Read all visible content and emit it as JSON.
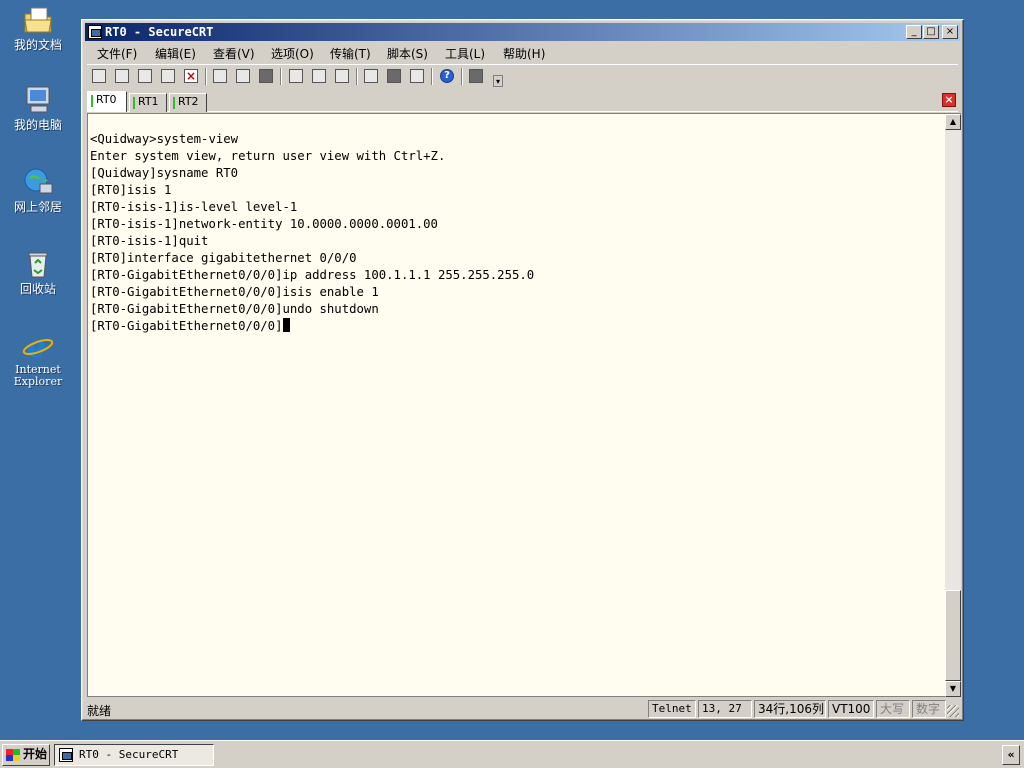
{
  "desktop": {
    "icons": [
      {
        "label": "我的文档",
        "icon": "my-documents-icon"
      },
      {
        "label": "我的电脑",
        "icon": "my-computer-icon"
      },
      {
        "label": "网上邻居",
        "icon": "network-places-icon"
      },
      {
        "label": "回收站",
        "icon": "recycle-bin-icon"
      },
      {
        "label_line1": "Internet",
        "label_line2": "Explorer",
        "icon": "internet-explorer-icon"
      }
    ]
  },
  "window": {
    "title": "RT0 - SecureCRT",
    "controls": {
      "minimize": "_",
      "maximize": "□",
      "close": "×"
    }
  },
  "menu": [
    "文件(F)",
    "编辑(E)",
    "查看(V)",
    "选项(O)",
    "传输(T)",
    "脚本(S)",
    "工具(L)",
    "帮助(H)"
  ],
  "toolbar": {
    "buttons": [
      "connect-icon",
      "quick-connect-icon",
      "connect-in-tab-icon",
      "reconnect-icon",
      "disconnect-icon",
      "copy-icon",
      "paste-icon",
      "find-icon",
      "print-icon",
      "print-selection-icon",
      "print-setup-icon",
      "session-options-icon",
      "global-options-icon",
      "keymap-icon",
      "help-icon",
      "sftp-icon"
    ],
    "help_glyph": "?",
    "overflow_glyph": "▾"
  },
  "tabs": [
    {
      "label": "RT0",
      "active": true
    },
    {
      "label": "RT1",
      "active": false
    },
    {
      "label": "RT2",
      "active": false
    }
  ],
  "tab_close": "×",
  "terminal": {
    "lines": [
      "<Quidway>system-view",
      "Enter system view, return user view with Ctrl+Z.",
      "[Quidway]sysname RT0",
      "[RT0]isis 1",
      "[RT0-isis-1]is-level level-1",
      "[RT0-isis-1]network-entity 10.0000.0000.0001.00",
      "[RT0-isis-1]quit",
      "[RT0]interface gigabitethernet 0/0/0",
      "[RT0-GigabitEthernet0/0/0]ip address 100.1.1.1 255.255.255.0",
      "[RT0-GigabitEthernet0/0/0]isis enable 1",
      "[RT0-GigabitEthernet0/0/0]undo shutdown",
      "[RT0-GigabitEthernet0/0/0]"
    ]
  },
  "scrollbar": {
    "up": "▲",
    "down": "▼"
  },
  "status": {
    "ready": "就绪",
    "protocol": "Telnet",
    "cursor_pos": "13,  27",
    "size": "34行,106列",
    "emulation": "VT100",
    "caps": "大写",
    "num": "数字"
  },
  "taskbar": {
    "start": "开始",
    "task": "RT0 - SecureCRT",
    "tray_toggle": "«"
  }
}
